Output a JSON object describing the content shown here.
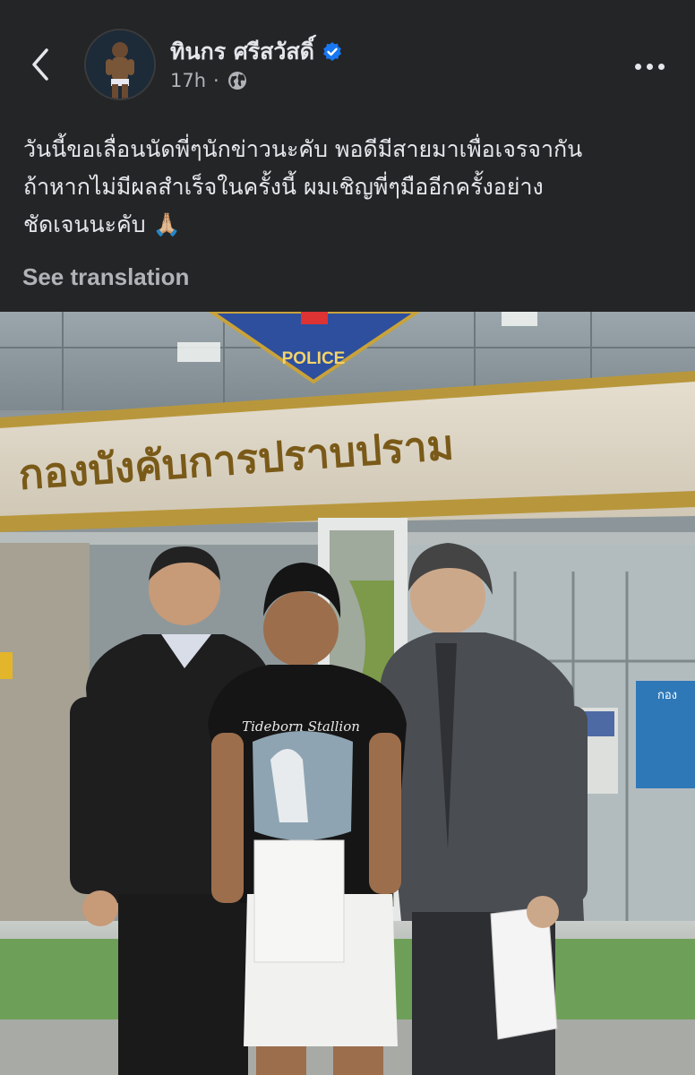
{
  "post": {
    "author_name": "ทินกร ศรีสวัสดิ์",
    "verified": true,
    "time": "17h",
    "separator": "·",
    "privacy_icon": "globe-icon",
    "text_lines": [
      "วันนี้ขอเลื่อนนัดพี่ๆนักข่าวนะคับ พอดีมีสายมาเพื่อเจรจากัน",
      "ถ้าหากไม่มีผลสำเร็จในครั้งนี้ ผมเชิญพี่ๆมืออีกครั้งอย่าง",
      "ชัดเจนนะคับ"
    ],
    "emoji": "🙏🏼",
    "see_translation": "See translation"
  },
  "photo": {
    "sign_main": "กองบังคับการปราบปราม",
    "badge_text": "POLICE",
    "shirt_text": "Tideborn Stallion",
    "kiosk_text": "กอง"
  },
  "colors": {
    "background": "#242526",
    "text_primary": "#e4e6eb",
    "text_secondary": "#b0b3b8",
    "verified_blue": "#1877f2"
  }
}
